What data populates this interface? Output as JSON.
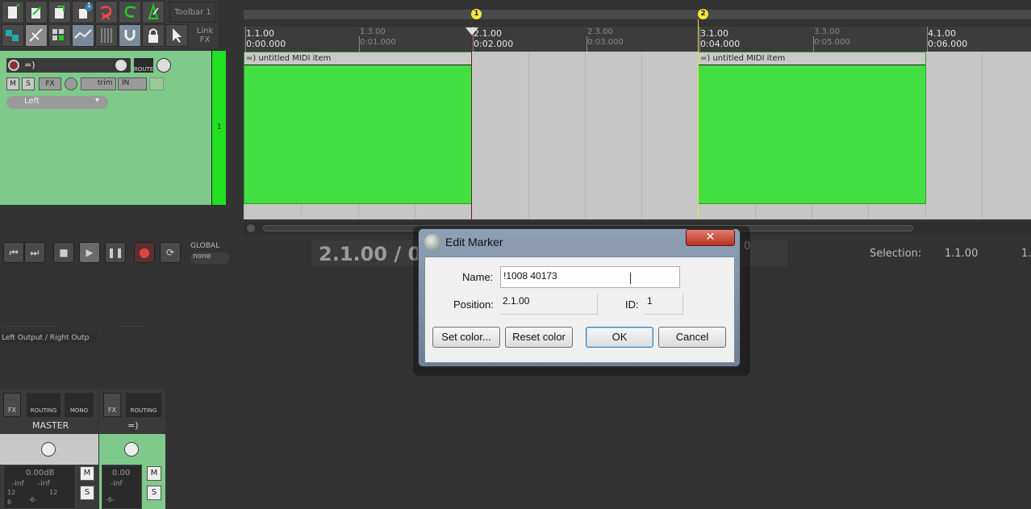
{
  "toolbar": {
    "title": "Toolbar 1",
    "link_fx_line1": "Link",
    "link_fx_line2": "FX",
    "badge": "1"
  },
  "track": {
    "name": "=)",
    "route_label": "ROUTE",
    "mute": "M",
    "solo": "S",
    "fx": "FX",
    "trim_label": "trim",
    "input_label": "IN",
    "channel_input": "Left",
    "track_number": "1"
  },
  "ruler": {
    "labels": [
      {
        "bar": "1.1.00",
        "time": "0:00.000"
      },
      {
        "bar": "1.3.00",
        "time": "0:01.000"
      },
      {
        "bar": "2.1.00",
        "time": "0:02.000"
      },
      {
        "bar": "2.3.00",
        "time": "0:03.000"
      },
      {
        "bar": "3.1.00",
        "time": "0:04.000"
      },
      {
        "bar": "3.3.00",
        "time": "0:05.000"
      },
      {
        "bar": "4.1.00",
        "time": "0:06.000"
      }
    ]
  },
  "markers": [
    {
      "number": "1"
    },
    {
      "number": "2"
    }
  ],
  "items": [
    {
      "name": "=) untitled MIDI item"
    },
    {
      "name": "=) untitled MIDI item"
    }
  ],
  "transport": {
    "global_label": "GLOBAL",
    "global_value": "none",
    "time_display": "2.1.00 / 0:0",
    "time_tail": "0",
    "selection_label": "Selection:",
    "selection_value": "1.1.00",
    "selection_trunc": "1."
  },
  "mixer": {
    "output_label": "Left Output / Right Outp",
    "master": {
      "name": "MASTER",
      "fx": "FX",
      "routing": "ROUTING",
      "mono": "MONO",
      "volume": "0.00dB",
      "peak_l": "-inf",
      "peak_r": "-inf",
      "scale_a": "12",
      "scale_b": "6",
      "scale_c": "-6-",
      "mute": "M",
      "solo": "S"
    },
    "track": {
      "name": "=)",
      "fx": "FX",
      "routing": "ROUTING",
      "volume": "0.00",
      "peak": "-inf",
      "scale_c": "-6-",
      "mute": "M",
      "solo": "S"
    }
  },
  "dialog": {
    "title": "Edit Marker",
    "close_glyph": "✕",
    "name_label": "Name:",
    "name_value": "!1008 40173",
    "position_label": "Position:",
    "position_value": "2.1.00",
    "id_label": "ID:",
    "id_value": "1",
    "set_color": "Set color...",
    "reset_color": "Reset color",
    "ok": "OK",
    "cancel": "Cancel"
  },
  "colors": {
    "midi_item": "#42de42",
    "track_strip": "#22e022",
    "marker": "#f5e83a",
    "track_panel": "#7fc98a"
  }
}
